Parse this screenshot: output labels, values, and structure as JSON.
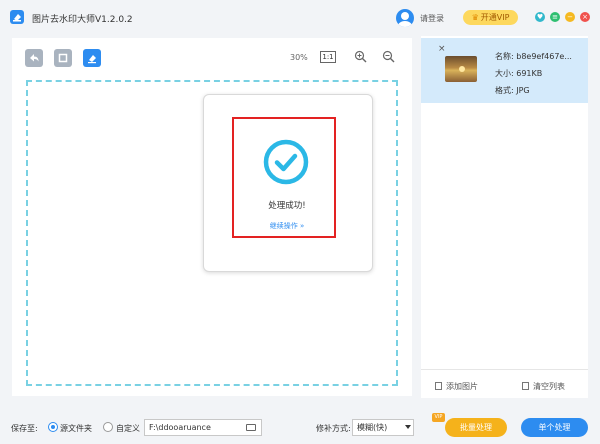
{
  "app": {
    "title": "图片去水印大师V1.2.0.2",
    "login_label": "请登录",
    "vip_label": "开通VIP",
    "window_controls": [
      "skin-icon",
      "menu-icon",
      "minimize-icon",
      "close-icon"
    ]
  },
  "toolbar": {
    "tools": [
      "undo-icon",
      "crop-icon",
      "eraser-icon"
    ],
    "active_tool": "eraser-icon",
    "zoom_percent": "30%",
    "zoom_fit_label": "1:1"
  },
  "result": {
    "message": "处理成功!",
    "continue_label": "继续操作 »"
  },
  "file_list": {
    "items": [
      {
        "name": "名称: b8e9ef467e...",
        "size": "大小: 691KB",
        "format": "格式: JPG"
      }
    ],
    "add_label": "添加图片",
    "clear_label": "清空列表"
  },
  "bottom": {
    "save_label": "保存至:",
    "option_source": "源文件夹",
    "option_custom": "自定义",
    "selected_option": "源文件夹",
    "path_value": "F:\\ddooaruance",
    "repair_label": "修补方式:",
    "repair_mode": "模糊(快)",
    "batch_label": "批量处理",
    "vip_badge": "VIP",
    "single_label": "单个处理"
  },
  "colors": {
    "accent": "#2d8cf0",
    "vip": "#fdd85e",
    "batch": "#f5b21b",
    "highlight": "#e32222",
    "dashed_border": "#79d1e3",
    "success": "#2bb8e6"
  }
}
